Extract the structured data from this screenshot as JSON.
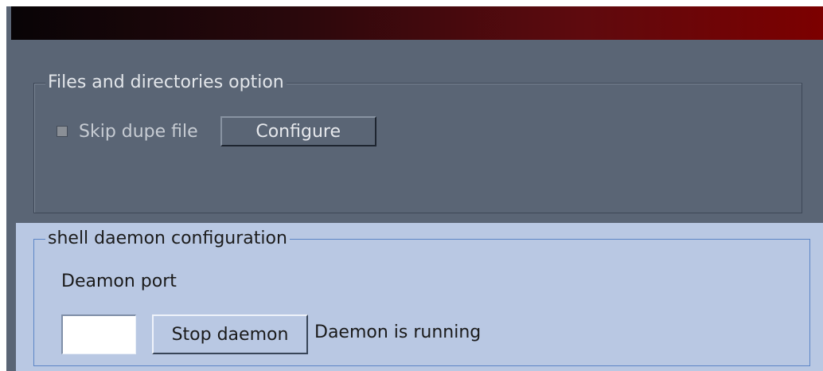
{
  "colors": {
    "window_bg": "#5a6575",
    "titlebar_start": "#080406",
    "titlebar_end": "#7c0000",
    "active_panel_bg": "#b9c8e3",
    "active_border": "#5c85c6"
  },
  "files_group": {
    "legend": "Files and directories option",
    "skip_dupe_label": "Skip dupe file",
    "configure_label": "Configure"
  },
  "daemon_group": {
    "legend": "shell daemon configuration",
    "port_label": "Deamon port",
    "port_value": "",
    "stop_label": "Stop daemon",
    "status": "Daemon is running"
  }
}
